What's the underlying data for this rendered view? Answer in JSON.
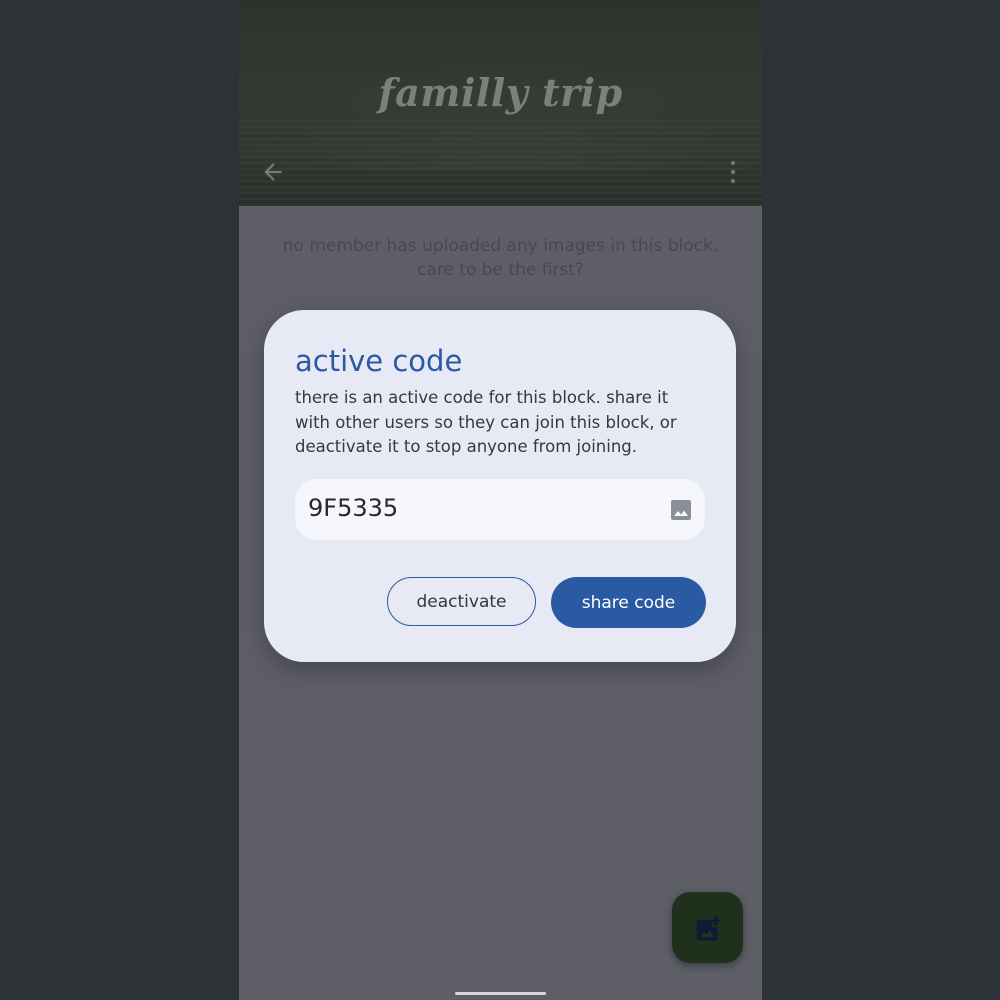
{
  "header": {
    "title": "familly trip",
    "back_icon": "arrow-back-icon",
    "menu_icon": "more-vert-icon"
  },
  "main": {
    "empty_message": "no member has uploaded any images in this block. care to be the first?"
  },
  "dialog": {
    "title": "active code",
    "body": "there is an active code for this block. share it with other users so they can join this block, or deactivate it to stop anyone from joining.",
    "code_value": "9F5335",
    "code_icon": "image-icon",
    "deactivate_label": "deactivate",
    "share_label": "share code"
  },
  "fab": {
    "icon": "add-photo-icon"
  },
  "colors": {
    "accent": "#2b5aa4",
    "dialog_bg": "#e7eaf5",
    "scrim_bg": "#5d5e66",
    "fab_bg": "#1f311d"
  }
}
